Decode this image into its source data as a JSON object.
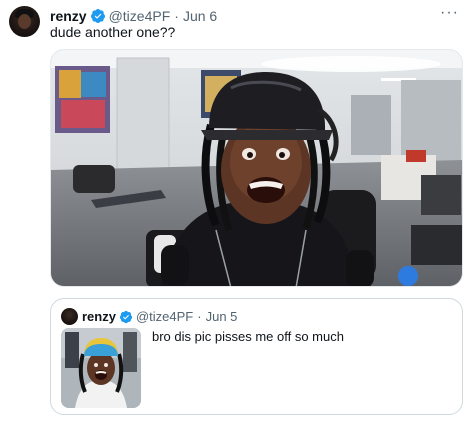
{
  "tweet": {
    "author_name": "renzy",
    "handle": "@tize4PF",
    "separator": "·",
    "date": "Jun 6",
    "text": "dude another one??",
    "more_label": "···"
  },
  "quoted_tweet": {
    "author_name": "renzy",
    "handle": "@tize4PF",
    "separator": "·",
    "date": "Jun 5",
    "text": "bro dis pic pisses me off so much"
  },
  "colors": {
    "verified_badge": "#1d9bf0",
    "text_primary": "#0f1419",
    "text_secondary": "#536471",
    "border": "#cfd9de"
  },
  "icons": {
    "verified": "verified-badge-icon",
    "more": "more-options-icon"
  }
}
